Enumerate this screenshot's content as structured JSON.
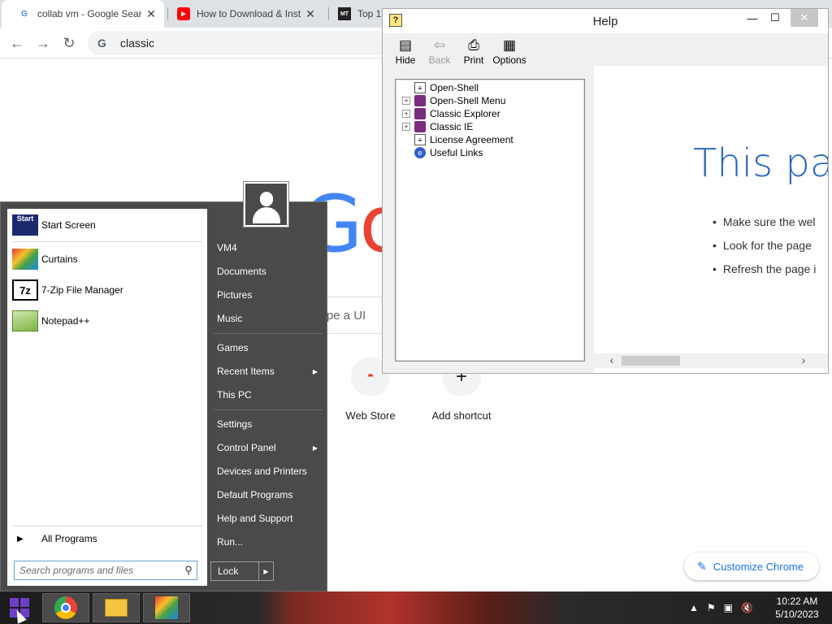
{
  "browser": {
    "tabs": [
      {
        "title": "collab vm - Google Searc",
        "favicon": "google-icon"
      },
      {
        "title": "How to Download & Inst",
        "favicon": "youtube-icon"
      },
      {
        "title": "Top 1",
        "favicon": "mt-icon",
        "favicon_text": "MT"
      }
    ],
    "omnibox_text": "classic",
    "search_placeholder": "r type a UI",
    "shortcuts": [
      {
        "label": "Web Store"
      },
      {
        "label": "Add shortcut"
      }
    ],
    "customize_label": "Customize Chrome"
  },
  "help_window": {
    "title": "Help",
    "toolbar": {
      "hide": "Hide",
      "back": "Back",
      "print": "Print",
      "options": "Options"
    },
    "tree": [
      {
        "label": "Open-Shell",
        "icon": "page-icon",
        "expandable": false
      },
      {
        "label": "Open-Shell Menu",
        "icon": "book-icon",
        "expandable": true
      },
      {
        "label": "Classic Explorer",
        "icon": "book-icon",
        "expandable": true
      },
      {
        "label": "Classic IE",
        "icon": "book-icon",
        "expandable": true
      },
      {
        "label": "License Agreement",
        "icon": "page-icon",
        "expandable": false
      },
      {
        "label": "Useful Links",
        "icon": "globe-icon",
        "expandable": false
      }
    ],
    "content": {
      "heading": "This pag",
      "bullets": [
        "Make sure the wel",
        "Look for the page",
        "Refresh the page i"
      ]
    }
  },
  "start_menu": {
    "pinned": [
      {
        "label": "Start Screen",
        "icon_text": "Start"
      },
      {
        "label": "Curtains",
        "icon_text": ""
      },
      {
        "label": "7-Zip File Manager",
        "icon_text": "7z"
      },
      {
        "label": "Notepad++",
        "icon_text": ""
      }
    ],
    "all_programs": "All Programs",
    "search_placeholder": "Search programs and files",
    "right_items": {
      "user": "VM4",
      "documents": "Documents",
      "pictures": "Pictures",
      "music": "Music",
      "games": "Games",
      "recent": "Recent Items",
      "this_pc": "This PC",
      "settings": "Settings",
      "control_panel": "Control Panel",
      "devices": "Devices and Printers",
      "default_programs": "Default Programs",
      "help": "Help and Support",
      "run": "Run..."
    },
    "lock_label": "Lock"
  },
  "taskbar": {
    "time": "10:22 AM",
    "date": "5/10/2023"
  },
  "colors": {
    "accent_blue": "#2b66c1",
    "start_menu_bg": "#4a4a4a",
    "chrome_link": "#1a73e8"
  }
}
